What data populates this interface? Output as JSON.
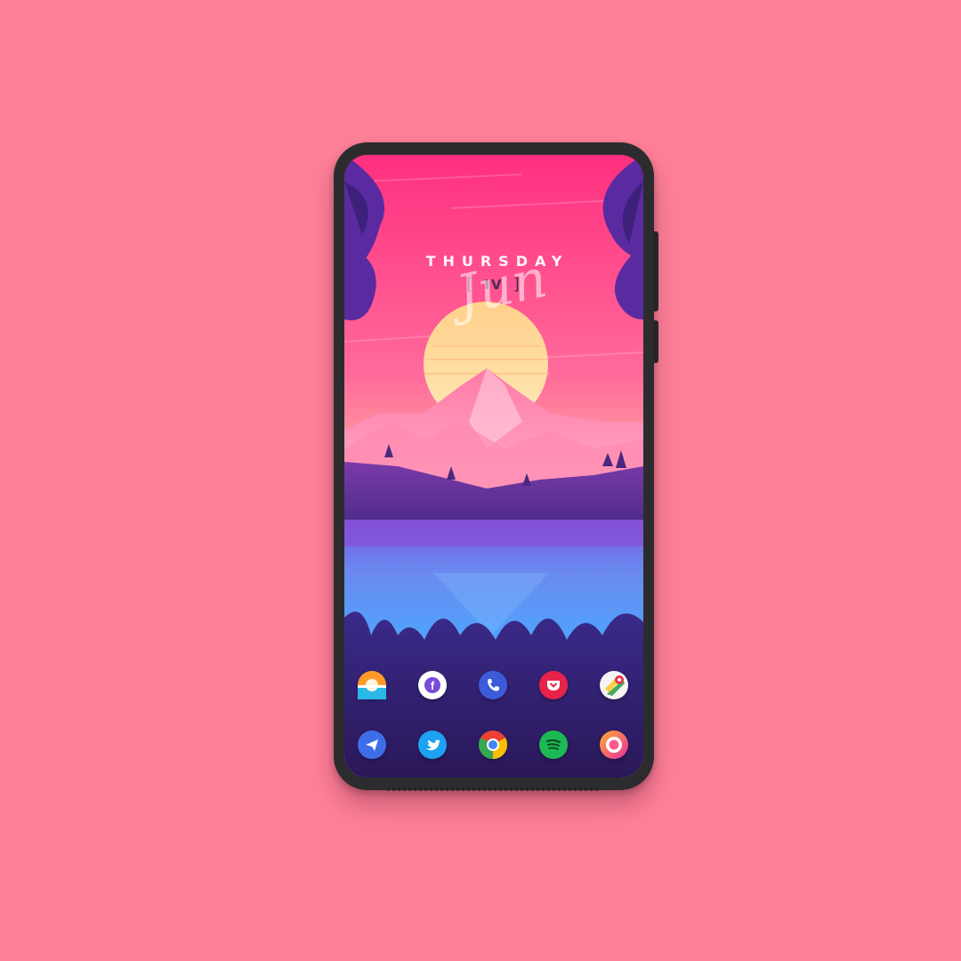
{
  "lockscreen": {
    "day_name": "THURSDAY",
    "day_number": "IV",
    "bracket_left": "[",
    "bracket_right": "]",
    "month": "Jun"
  },
  "colors": {
    "background": "#ff8199",
    "phone_frame": "#2c2c2e",
    "sky_top": "#ff3d8a",
    "sun": "#ffd38a",
    "lake": "#5aa0ff",
    "ground": "#2c1a60"
  },
  "dock": {
    "row1": [
      {
        "icon": "weather-app-icon",
        "color": "#ff8a2a"
      },
      {
        "icon": "facebook-icon",
        "color": "#ffffff"
      },
      {
        "icon": "phone-icon",
        "color": "#3d5bd9"
      },
      {
        "icon": "pocket-icon",
        "color": "#e8234a"
      },
      {
        "icon": "maps-icon",
        "color": "#f4f4f4"
      }
    ],
    "row2": [
      {
        "icon": "telegram-icon",
        "color": "#3d6ee8"
      },
      {
        "icon": "twitter-icon",
        "color": "#1da1f2"
      },
      {
        "icon": "chrome-icon",
        "color": "#ea4335"
      },
      {
        "icon": "spotify-icon",
        "color": "#1db954"
      },
      {
        "icon": "camera-icon",
        "color": "#ff6a3d"
      }
    ]
  }
}
